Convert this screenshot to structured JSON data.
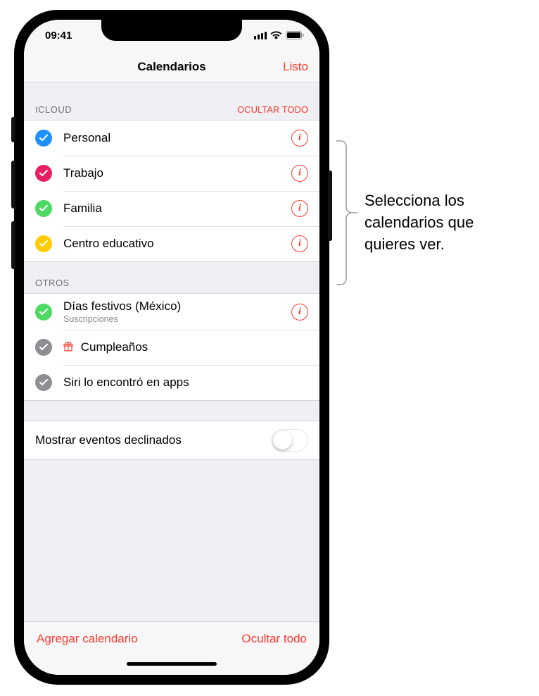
{
  "status": {
    "time": "09:41"
  },
  "nav": {
    "title": "Calendarios",
    "done": "Listo"
  },
  "sections": {
    "icloud": {
      "label": "ICLOUD",
      "action": "OCULTAR TODO"
    },
    "others": {
      "label": "OTROS"
    }
  },
  "icloud_items": [
    {
      "label": "Personal",
      "color": "#1e90ff"
    },
    {
      "label": "Trabajo",
      "color": "#e91e63"
    },
    {
      "label": "Familia",
      "color": "#4cd964"
    },
    {
      "label": "Centro educativo",
      "color": "#ffcc00"
    }
  ],
  "other_items": [
    {
      "label": "Días festivos (México)",
      "sub": "Suscripciones",
      "color": "#4cd964",
      "info": true
    },
    {
      "label": "Cumpleaños",
      "color": "#8e8e93",
      "gift": true
    },
    {
      "label": "Siri lo encontró en apps",
      "color": "#8e8e93"
    }
  ],
  "toggle": {
    "label": "Mostrar eventos declinados",
    "value": false
  },
  "toolbar": {
    "add": "Agregar calendario",
    "hide": "Ocultar todo"
  },
  "callout": {
    "text": "Selecciona los calendarios que quieres ver."
  }
}
